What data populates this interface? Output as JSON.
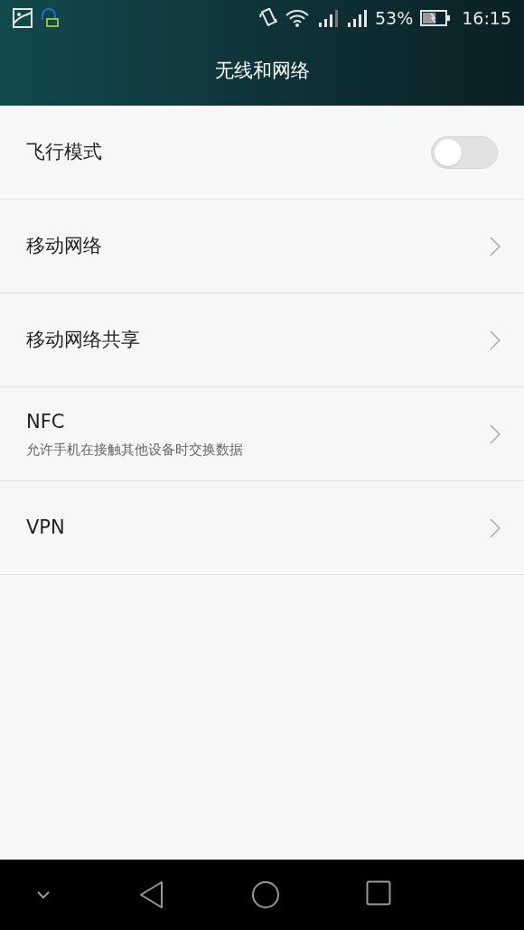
{
  "status_bar": {
    "battery": "53%",
    "time": "16:15"
  },
  "title": "无线和网络",
  "items": [
    {
      "kind": "toggle",
      "label": "飞行模式",
      "on": false
    },
    {
      "kind": "link",
      "label": "移动网络"
    },
    {
      "kind": "link",
      "label": "移动网络共享"
    },
    {
      "kind": "link",
      "label": "NFC",
      "summary": "允许手机在接触其他设备时交换数据"
    },
    {
      "kind": "link",
      "label": "VPN"
    }
  ]
}
